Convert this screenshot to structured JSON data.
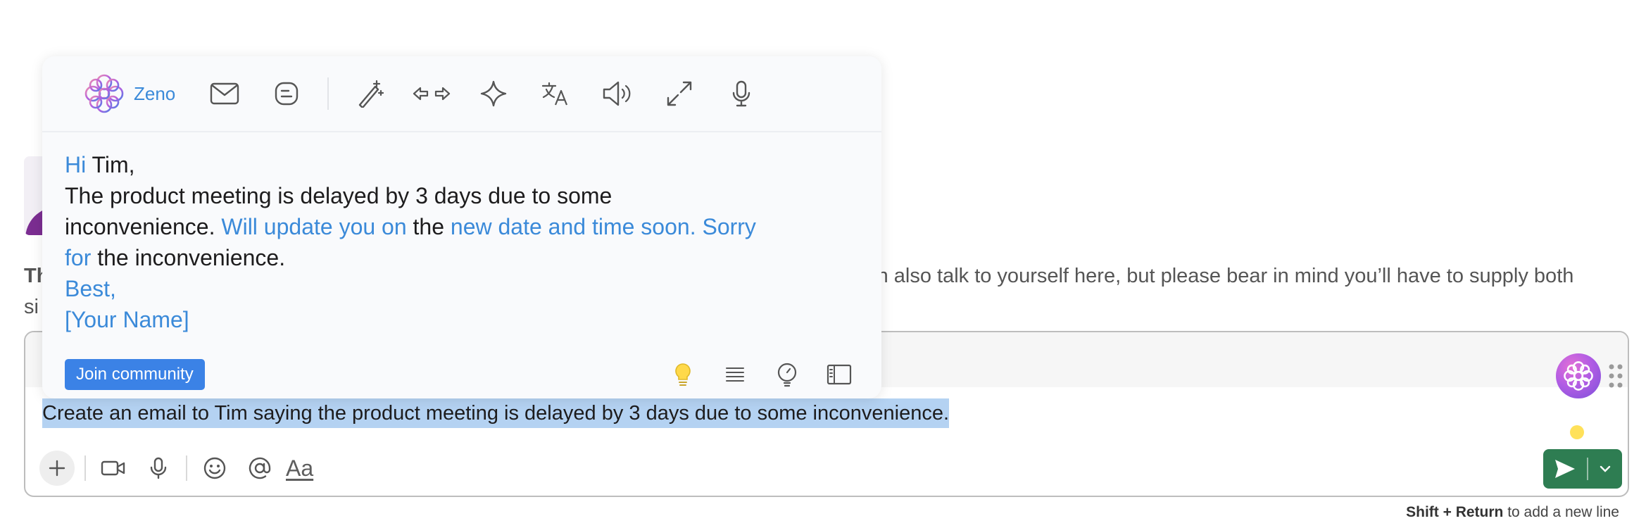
{
  "background": {
    "intro_prefix": "Th",
    "intro_text": "an also talk to yourself here, but please bear in mind you’ll have to supply both",
    "intro_line2": "si"
  },
  "popup": {
    "brand": "Zeno",
    "toolbar_icons": [
      "mail-icon",
      "blog-icon",
      "magic-wand-icon",
      "arrows-left-right-icon",
      "sparkle-icon",
      "translate-icon",
      "speaker-icon",
      "shrink-expand-icon",
      "microphone-icon"
    ],
    "body": {
      "hi": "Hi",
      "name": " Tim,",
      "line2": "The product meeting is delayed by 3 days due to some",
      "line3_a": "inconvenience. ",
      "line3_b": "Will update you on",
      "line3_c": " the ",
      "line3_d": "new date and time soon. Sorry",
      "line4_a": "for",
      "line4_b": " the inconvenience.",
      "closing": "Best,",
      "signature": "[Your Name]"
    },
    "join_label": "Join community",
    "footer_icons": [
      "bulb-lit-icon",
      "align-icon",
      "bulb-outline-icon",
      "sidebar-panel-icon"
    ]
  },
  "composer": {
    "selected_text": "Create an email to Tim saying the product meeting is delayed by 3 days due to some inconvenience.",
    "format_label": "Aa",
    "send_color": "#2e7d52"
  },
  "hint": {
    "keys": "Shift + Return",
    "text": " to add a new line"
  },
  "colors": {
    "accent_blue": "#3b8ad9",
    "selection": "#b4d2f2"
  }
}
